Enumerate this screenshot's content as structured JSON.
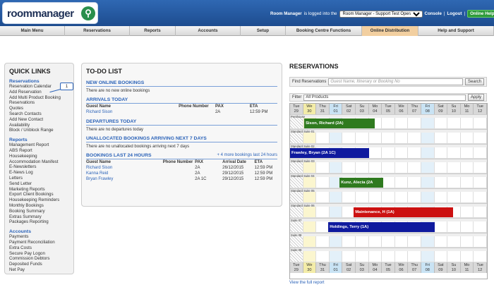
{
  "header": {
    "logo_text": "roommanager",
    "logged_in_prefix": "Room Manager",
    "logged_in_mid": " is logged into the ",
    "account": "Room Manager - Support Test Operator",
    "console": "Console",
    "logout": "Logout",
    "online_help": "Online Help"
  },
  "nav": [
    "Main Menu",
    "Reservations",
    "Reports",
    "Accounts",
    "Setup",
    "Booking Centre Functions",
    "Online Distribution",
    "Help and Support"
  ],
  "quick_links": {
    "title": "QUICK LINKS",
    "sections": [
      {
        "name": "Reservations",
        "items": [
          "Reservation Calendar",
          "Add Reservation",
          "Add Multi Product Booking",
          "Reservations",
          "Quotes",
          "Search Contacts",
          "Add New Contact",
          "Availability",
          "Block / Unblock Range"
        ]
      },
      {
        "name": "Reports",
        "items": [
          "Management Report",
          "ABS Report",
          "Housekeeping",
          "Accommodation Manifest",
          "E-Newsletters",
          "E-News Log",
          "Letters",
          "Send Letter",
          "Marketing Reports",
          "Export Client Bookings",
          "Housekeeping Reminders",
          "Monthly Bookings",
          "Booking Summary",
          "Extras Summary",
          "Packages Reporting"
        ]
      },
      {
        "name": "Accounts",
        "items": [
          "Payments",
          "Payment Reconciliation",
          "Extra Costs",
          "Secure Pay Logon",
          "Commission Debtors",
          "Deposited Funds",
          "Net Pay"
        ]
      }
    ],
    "callout": "1"
  },
  "todo": {
    "title": "TO-DO LIST",
    "new_online": {
      "heading": "NEW ONLINE BOOKINGS",
      "text": "There are no new online bookings"
    },
    "arrivals": {
      "heading": "ARRIVALS TODAY",
      "cols": [
        "Guest Name",
        "Phone Number",
        "PAX",
        "ETA"
      ],
      "rows": [
        [
          "Richard Sison",
          "",
          "2A",
          "12:59 PM"
        ]
      ]
    },
    "departures": {
      "heading": "DEPARTURES TODAY",
      "text": "There are no departures today"
    },
    "unallocated": {
      "heading": "UNALLOCATED BOOKINGS ARRIVING NEXT 7 DAYS",
      "text": "There are no unallocated bookings arriving next 7 days"
    },
    "last24": {
      "heading": "BOOKINGS LAST 24 HOURS",
      "more": "+ 4 more bookings last 24 hours",
      "cols": [
        "Guest Name",
        "Phone Number",
        "PAX",
        "Arrival Date",
        "ETA"
      ],
      "rows": [
        [
          "Richard Sison",
          "",
          "2A",
          "26/12/2015",
          "12:59 PM"
        ],
        [
          "Kanna Reid",
          "",
          "2A",
          "29/12/2015",
          "12:59 PM"
        ],
        [
          "Bryan Frawley",
          "",
          "2A 1C",
          "29/12/2015",
          "12:59 PM"
        ]
      ]
    }
  },
  "reservations": {
    "title": "RESERVATIONS",
    "search_label": "Find Reservations",
    "search_placeholder": "Guest Name, Itinerary or Booking No",
    "search_btn": "Search",
    "filter_label": "Filter",
    "filter_value": "All Products",
    "apply_btn": "Apply",
    "days": [
      [
        "Tue",
        "29"
      ],
      [
        "We",
        "30"
      ],
      [
        "Thu",
        "31"
      ],
      [
        "Fri",
        "01"
      ],
      [
        "Sat",
        "02"
      ],
      [
        "Su",
        "03"
      ],
      [
        "Mo",
        "04"
      ],
      [
        "Tue",
        "05"
      ],
      [
        "We",
        "06"
      ],
      [
        "Thu",
        "07"
      ],
      [
        "Fri",
        "08"
      ],
      [
        "Sat",
        "09"
      ],
      [
        "Su",
        "10"
      ],
      [
        "Mo",
        "11"
      ],
      [
        "Tue",
        "12"
      ]
    ],
    "rooms": [
      "Penthouse",
      "Standard Suite 01",
      "Standard Suite 02",
      "Standard Suite 03",
      "Standard Suite 04",
      "Standard Suite 05",
      "Standard Suite 06",
      "Suite 07",
      "Suite 08",
      "Suite 09"
    ],
    "bookings": [
      {
        "room": 0,
        "start": 1,
        "span": 5,
        "label": "Sison, Richard (2A)",
        "color": "#2f7a1f"
      },
      {
        "room": 2,
        "start": 0,
        "span": 5.6,
        "label": "Frawley, Bryan (2A 1C)",
        "color": "#0f1a9e"
      },
      {
        "room": 4,
        "start": 3.5,
        "span": 3.1,
        "label": "Kunz, Alecia (2A",
        "color": "#2f7a1f"
      },
      {
        "room": 6,
        "start": 4.5,
        "span": 7,
        "label": "Maintenance, H (1A)",
        "color": "#cc1111"
      },
      {
        "room": 7,
        "start": 2.7,
        "span": 7.5,
        "label": "Holdings, Terry (1A)",
        "color": "#0f1a9e"
      }
    ],
    "full_report": "View the full report"
  }
}
